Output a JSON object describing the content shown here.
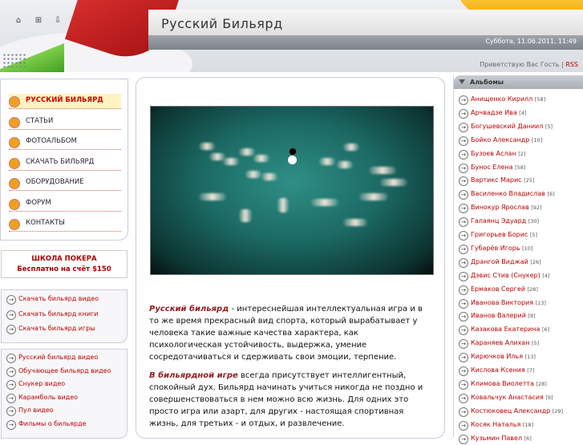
{
  "header": {
    "site_title": "Русский Бильярд",
    "date": "Суббота, 11.06.2011, 11:49",
    "greeting": "Приветствую Вас Гость",
    "separator": "|",
    "rss": "RSS",
    "icons": [
      "home-icon",
      "bookmark-icon",
      "login-icon"
    ]
  },
  "menu": {
    "items": [
      {
        "label": "РУССКИЙ БИЛЬЯРД",
        "active": true
      },
      {
        "label": "СТАТЬИ",
        "active": false
      },
      {
        "label": "ФОТОАЛЬБОМ",
        "active": false
      },
      {
        "label": "СКАЧАТЬ БИЛЬЯРД",
        "active": false
      },
      {
        "label": "ОБОРУДОВАНИЕ",
        "active": false
      },
      {
        "label": "ФОРУМ",
        "active": false
      },
      {
        "label": "КОНТАКТЫ",
        "active": false
      }
    ]
  },
  "promo": {
    "title": "ШКОЛА ПОКЕРА",
    "subtitle": "Бесплатно на счёт $150"
  },
  "downloads": [
    "Скачать бильярд видео",
    "Скачать бильярд книги",
    "Скачать бильярд игры"
  ],
  "videos": [
    "Русский бильярд видео",
    "Обучающее бильярд видео",
    "Снукер видео",
    "Карамболь видео",
    "Пул видео",
    "Фильмы о бильярде"
  ],
  "content": {
    "para1_lead": "Русский бильярд",
    "para1_text": " - интереснейшая интеллектуальная игра и в то же время прекрасный вид спорта, который вырабатывает у человека такие важные качества характера, как психологическая устойчивость, выдержка, умение сосредотачиваться и сдерживать свои эмоции, терпение.",
    "para2_lead": "В бильярдной игре",
    "para2_text": " всегда присутствует  интеллигентный, спокойный дух. Бильярд начинать учиться никогда не поздно и совершенствоваться в нем можно всю жизнь. Для одних это просто игра или азарт, для других - настоящая спортивная жизнь, для третьих - и отдых, и развлечение."
  },
  "albums": {
    "title": "Альбомы",
    "items": [
      {
        "name": "Анищенко Кирилл",
        "count": "[58]"
      },
      {
        "name": "Арчвадзе Ива",
        "count": "[4]"
      },
      {
        "name": "Богушевский Даниил",
        "count": "[5]"
      },
      {
        "name": "Бойко Александр",
        "count": "[10]"
      },
      {
        "name": "Бузоев Аслан",
        "count": "[2]"
      },
      {
        "name": "Бунос Елена",
        "count": "[58]"
      },
      {
        "name": "Вартикс Марис",
        "count": "[25]"
      },
      {
        "name": "Василенко Владислав",
        "count": "[6]"
      },
      {
        "name": "Винокур Ярослав",
        "count": "[92]"
      },
      {
        "name": "Галаянц Эдуард",
        "count": "[30]"
      },
      {
        "name": "Григорьев Борис",
        "count": "[5]"
      },
      {
        "name": "Губарёв Игорь",
        "count": "[10]"
      },
      {
        "name": "Дрангой Виджай",
        "count": "[26]"
      },
      {
        "name": "Дэвис Стив (Снукер)",
        "count": "[4]"
      },
      {
        "name": "Ермаков Сергей",
        "count": "[28]"
      },
      {
        "name": "Иванова Виктория",
        "count": "[13]"
      },
      {
        "name": "Иванов Валерий",
        "count": "[8]"
      },
      {
        "name": "Казакова Екатерина",
        "count": "[6]"
      },
      {
        "name": "Караняев Алихан",
        "count": "[5]"
      },
      {
        "name": "Кирючков Илья",
        "count": "[13]"
      },
      {
        "name": "Кислова Ксения",
        "count": "[7]"
      },
      {
        "name": "Климова Виолетта",
        "count": "[28]"
      },
      {
        "name": "Ковальчук Анастасия",
        "count": "[9]"
      },
      {
        "name": "Костюковец Александр",
        "count": "[29]"
      },
      {
        "name": "Косяк Наталья",
        "count": "[18]"
      },
      {
        "name": "Кузьмин Павел",
        "count": "[6]"
      }
    ]
  }
}
